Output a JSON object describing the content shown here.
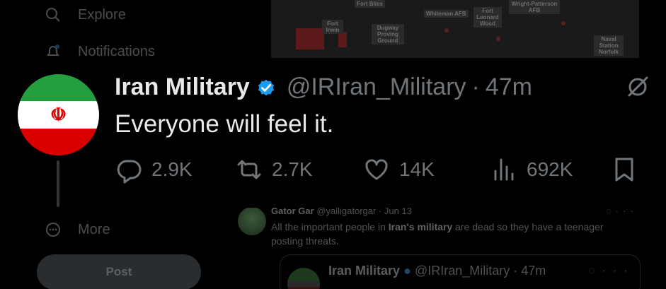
{
  "background": {
    "nav": {
      "explore_label": "Explore",
      "notifications_label": "Notifications",
      "more_label": "More",
      "post_label": "Post"
    },
    "map_labels": [
      "Fort Bliss",
      "Fort Irwin",
      "Dugway Proving Ground",
      "Whiteman AFB",
      "Fort Leonard Wood",
      "Wright-Patterson AFB",
      "Naval Station Norfolk"
    ],
    "reply": {
      "author": "Gator Gar",
      "handle": "@yalligatorgar",
      "time": "Jun 13",
      "text_prefix": "All the important people in ",
      "text_bold1": "Iran's military",
      "text_middle": " are dead so they have a teenager",
      "text_suffix": "posting threats."
    },
    "quote": {
      "author": "Iran Military",
      "handle": "@IRIran_Military",
      "time": "47m"
    }
  },
  "tweet": {
    "author": "Iran Military",
    "handle": "@IRIran_Military",
    "separator": "·",
    "time": "47m",
    "text": "Everyone will feel it.",
    "avatar_emblem": "☫",
    "replies": "2.9K",
    "reposts": "2.7K",
    "likes": "14K",
    "views": "692K"
  },
  "colors": {
    "verified": "#1d9bf0",
    "flag_green": "#239f40",
    "flag_red": "#da0000",
    "muted_text": "#71767b"
  }
}
